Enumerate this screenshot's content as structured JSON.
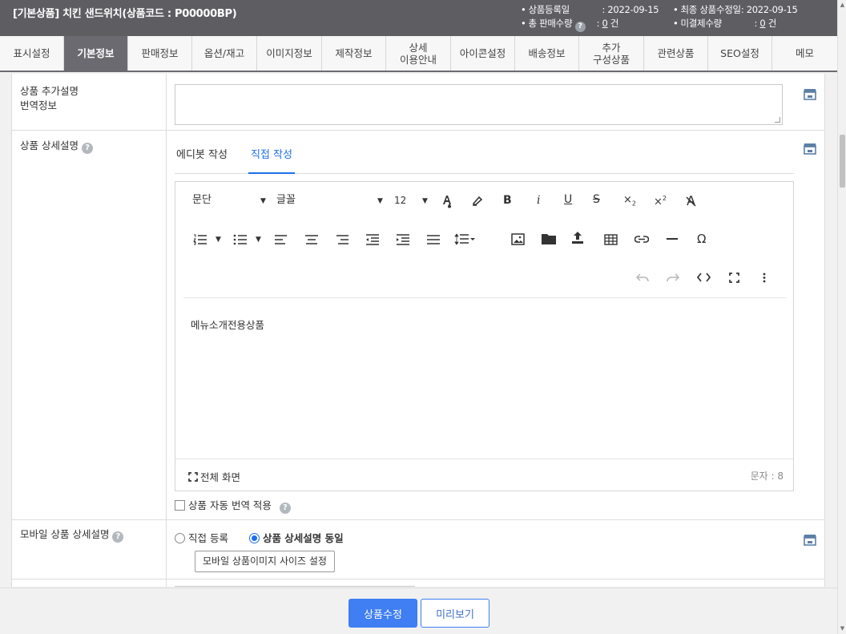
{
  "header": {
    "title": "[기본상품] 치킨 샌드위치(상품코드 : P00000BP)",
    "reg_date_label": "상품등록일",
    "reg_date_value": ": 2022-09-15",
    "total_sales_label": "총 판매수량",
    "total_sales_value": "0",
    "total_sales_unit": " 건",
    "mod_date_label": "최종 상품수정일",
    "mod_date_value": ": 2022-09-15",
    "unpaid_label": "미결제수량",
    "unpaid_value": "0",
    "unpaid_unit": " 건",
    "help_glyph": "?",
    "colon": ":"
  },
  "tabs": [
    {
      "label": "표시설정"
    },
    {
      "label": "기본정보",
      "active": true
    },
    {
      "label": "판매정보"
    },
    {
      "label": "옵션/재고"
    },
    {
      "label": "이미지정보"
    },
    {
      "label": "제작정보"
    },
    {
      "label": "상세\n이용안내"
    },
    {
      "label": "아이콘설정"
    },
    {
      "label": "배송정보"
    },
    {
      "label": "추가\n구성상품"
    },
    {
      "label": "관련상품"
    },
    {
      "label": "SEO설정"
    },
    {
      "label": "메모"
    }
  ],
  "form": {
    "row1_label_line1": "상품 추가설명",
    "row1_label_line2": "번역정보",
    "row2_label": "상품 상세설명",
    "row3_label": "모바일 상품 상세설명",
    "editor_tab_1": "에디봇 작성",
    "editor_tab_2": "직접 작성",
    "toolbar": {
      "paragraph": "문단",
      "font": "글꼴",
      "font_size": "12"
    },
    "editor_content": "메뉴소개전용상품",
    "fullscreen_label": "전체 화면",
    "char_count": "문자 : 8",
    "auto_translate_label": "상품 자동 번역 적용",
    "radio_direct": "직접 등록",
    "radio_same": "상품 상세설명 동일",
    "mobile_image_button": "모바일 상품이미지 사이즈 설정"
  },
  "bottom": {
    "save_button": "상품수정",
    "preview_button": "미리보기"
  },
  "colors": {
    "header_bg": "#5d5d62",
    "active_tab_bg": "#6a6a70",
    "accent_blue": "#3f7ef3"
  }
}
